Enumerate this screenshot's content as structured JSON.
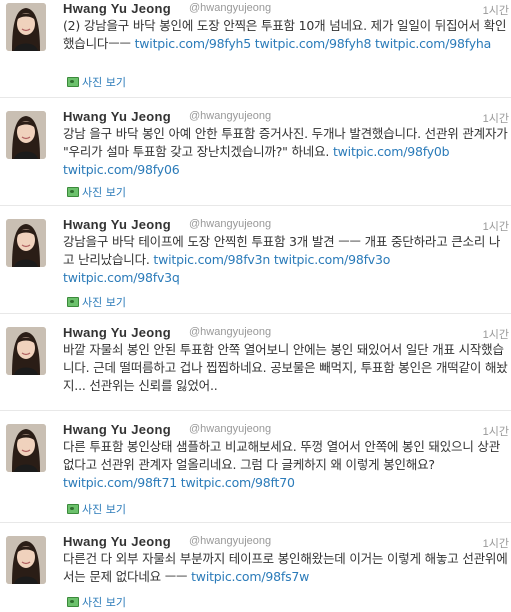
{
  "tweets": [
    {
      "author_name": "Hwang Yu Jeong",
      "author_handle": "@hwangyujeong",
      "timestamp": "1시간",
      "text": "(2) 강남을구 바닥 봉인에 도장 안찍은 투표함 10개 넘네요. 제가 일일이 뒤집어서 확인했습니다ㅡㅡ ",
      "links": [
        "twitpic.com/98fyh5",
        "twitpic.com/98fyh8",
        "twitpic.com/98fyha"
      ],
      "media_label": "사진 보기"
    },
    {
      "author_name": "Hwang Yu Jeong",
      "author_handle": "@hwangyujeong",
      "timestamp": "1시간",
      "text": "강남 을구 바닥 봉인 아예 안한 투표함 증거사진. 두개나 발견했습니다. 선관위 관계자가 \"우리가 설마 투표함 갖고 장난치겠습니까?\" 하네요. ",
      "links": [
        "twitpic.com/98fy0b",
        "twitpic.com/98fy06"
      ],
      "media_label": "사진 보기"
    },
    {
      "author_name": "Hwang Yu Jeong",
      "author_handle": "@hwangyujeong",
      "timestamp": "1시간",
      "text": "강남을구 바닥 테이프에 도장 안찍힌 투표함 3개 발견 ㅡㅡ 개표 중단하라고 큰소리 나고 난리났습니다. ",
      "links": [
        "twitpic.com/98fv3n",
        "twitpic.com/98fv3o",
        "twitpic.com/98fv3q"
      ],
      "media_label": "사진 보기"
    },
    {
      "author_name": "Hwang Yu Jeong",
      "author_handle": "@hwangyujeong",
      "timestamp": "1시간",
      "text": "바깥 자물쇠 봉인 안된 투표함 안쪽 열어보니 안에는 봉인 돼있어서 일단 개표 시작했습니다. 근데 떨떠름하고 겁나 찝찝하네요. 공보물은 빼먹지, 투표함 봉인은 개떡같이 해놨지... 선관위는 신뢰를 잃었어..",
      "links": [],
      "media_label": ""
    },
    {
      "author_name": "Hwang Yu Jeong",
      "author_handle": "@hwangyujeong",
      "timestamp": "1시간",
      "text": "다른 투표함 봉인상태 샘플하고 비교해보세요. 뚜껑 열어서 안쪽에 봉인 돼있으니 상관 없다고 선관위 관계자 얼올리네요. 그럼 다 글케하지 왜 이렇게 봉인해요? ",
      "links": [
        "twitpic.com/98ft71",
        "twitpic.com/98ft70"
      ],
      "media_label": "사진 보기"
    },
    {
      "author_name": "Hwang Yu Jeong",
      "author_handle": "@hwangyujeong",
      "timestamp": "1시간",
      "text": "다른건 다 외부 자물쇠 부분까지 테이프로 봉인해왔는데 이거는 이렇게 해놓고 선관위에서는 문제 없다네요 ㅡㅡ ",
      "links": [
        "twitpic.com/98fs7w"
      ],
      "media_label": "사진 보기"
    }
  ]
}
